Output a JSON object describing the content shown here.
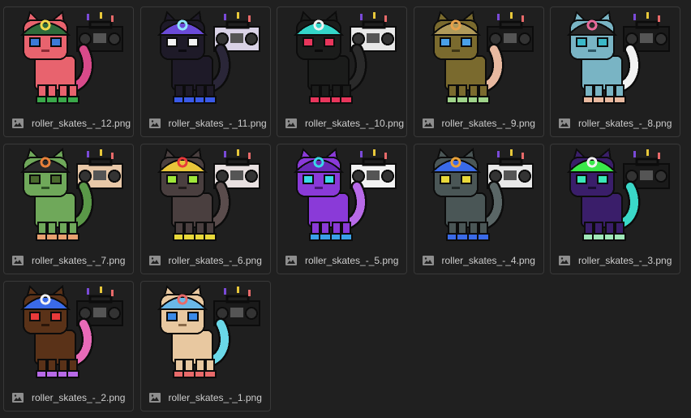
{
  "gallery": {
    "items": [
      {
        "name": "roller_skates_-_12.png",
        "fur": "#e8636e",
        "dark": "#8a2b36",
        "hat": "#2f6b3b",
        "hat_accent": "#f2d94a",
        "eye": "#3d7bd8",
        "skate": "#3aa84a",
        "tail2": "#d84a8a",
        "boombox": "#1a1a1a"
      },
      {
        "name": "roller_skates_-_11.png",
        "fur": "#1e1a28",
        "dark": "#0b0a10",
        "hat": "#6a4ad8",
        "hat_accent": "#8fe7ff",
        "eye": "#f2f2f2",
        "skate": "#3a5ae8",
        "tail2": "#2a2638",
        "boombox": "#d9d2e6"
      },
      {
        "name": "roller_skates_-_10.png",
        "fur": "#1b1c1b",
        "dark": "#0a0a0a",
        "hat": "#34d6c9",
        "hat_accent": "#f2f2f2",
        "eye": "#e8365c",
        "skate": "#e8365c",
        "tail2": "#2a2a2a",
        "boombox": "#e8e8e8"
      },
      {
        "name": "roller_skates_-_9.png",
        "fur": "#7a6a2e",
        "dark": "#3e3616",
        "hat": "#b09a5a",
        "hat_accent": "#e8a14a",
        "eye": "#4aa0e8",
        "skate": "#9fd38a",
        "tail2": "#e8b9a0",
        "boombox": "#1a1a1a"
      },
      {
        "name": "roller_skates_-_8.png",
        "fur": "#79b4c4",
        "dark": "#2e5866",
        "hat": "#2a2a2a",
        "hat_accent": "#e86a9a",
        "eye": "#3ab8c8",
        "skate": "#e8b9a0",
        "tail2": "#f2f2f2",
        "boombox": "#1a1a1a"
      },
      {
        "name": "roller_skates_-_7.png",
        "fur": "#6fa85a",
        "dark": "#2e5226",
        "hat": "#2a2a2a",
        "hat_accent": "#e8803a",
        "eye": "#4a6a2e",
        "skate": "#e8a070",
        "tail2": "#5a9848",
        "boombox": "#e8c8a8"
      },
      {
        "name": "roller_skates_-_6.png",
        "fur": "#4a3f3f",
        "dark": "#221c1c",
        "hat": "#e8c53a",
        "hat_accent": "#e83a3a",
        "eye": "#9fe83a",
        "skate": "#e8d83a",
        "tail2": "#5a4c4c",
        "boombox": "#e8e0e0"
      },
      {
        "name": "roller_skates_-_5.png",
        "fur": "#8a3ad8",
        "dark": "#4a1a78",
        "hat": "#6a2ab8",
        "hat_accent": "#3ad8e8",
        "eye": "#3ad8e8",
        "skate": "#3aa0e8",
        "tail2": "#b86ae8",
        "boombox": "#f2f2f2"
      },
      {
        "name": "roller_skates_-_4.png",
        "fur": "#4a5656",
        "dark": "#222a2a",
        "hat": "#3a6ae8",
        "hat_accent": "#e8a03a",
        "eye": "#e8d83a",
        "skate": "#3a6ae8",
        "tail2": "#5a6666",
        "boombox": "#e8e8e8"
      },
      {
        "name": "roller_skates_-_3.png",
        "fur": "#3a1e6a",
        "dark": "#1a0c32",
        "hat": "#3ae84a",
        "hat_accent": "#f2f2f2",
        "eye": "#3ae8b8",
        "skate": "#9fe8b8",
        "tail2": "#3ad8c8",
        "boombox": "#1a1a1a"
      },
      {
        "name": "roller_skates_-_2.png",
        "fur": "#5a3218",
        "dark": "#2a160a",
        "hat": "#3a6ae8",
        "hat_accent": "#f2f2f2",
        "eye": "#e83a3a",
        "skate": "#b86ae8",
        "tail2": "#e86ab8",
        "boombox": "#1a1a1a"
      },
      {
        "name": "roller_skates_-_1.png",
        "fur": "#e8c8a0",
        "dark": "#8a6a48",
        "hat": "#6ab8e8",
        "hat_accent": "#e86a6a",
        "eye": "#3a8ae8",
        "skate": "#e86a6a",
        "tail2": "#6ad8e8",
        "boombox": "#1a1a1a"
      }
    ]
  }
}
